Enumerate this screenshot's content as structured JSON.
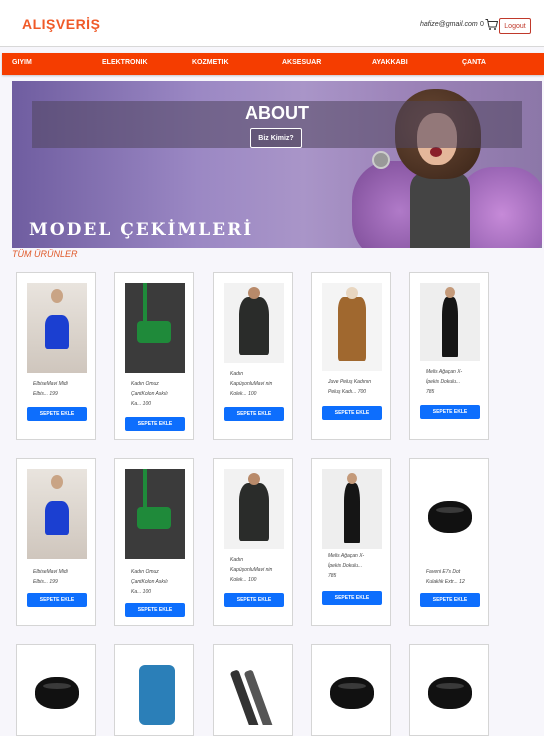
{
  "header": {
    "brand": "ALIŞVERİŞ",
    "email": "hafize@gmail.com",
    "cart_count": "0",
    "logout_label": "Logout"
  },
  "nav": {
    "items": [
      "GIYIM",
      "ELEKTRONIK",
      "KOZMETIK",
      "AKSESUAR",
      "AYAKKABI",
      "ÇANTA"
    ]
  },
  "hero": {
    "title": "ABOUT",
    "button_label": "Biz Kimiz?",
    "caption": "MODEL ÇEKİMLERİ"
  },
  "section_title": "TÜM ÜRÜNLER",
  "add_to_cart_label": "SEPETE EKLE",
  "products": [
    {
      "l1": "ElbiseMavi Midi",
      "l2": "Elbis... 199",
      "l3": ""
    },
    {
      "l1": "Kadın Omuz",
      "l2": "ÇantKolon Askılı",
      "l3": "Ka... 100"
    },
    {
      "l1": "Kadın",
      "l2": "KapüşonluMavi nin",
      "l3": "Kolek... 100"
    },
    {
      "l1": "Juve Peluş Kadının",
      "l2": "Peluş Kadı... 700",
      "l3": ""
    },
    {
      "l1": "Melis Ağaçan X-",
      "l2": "İpekis Dokulu...",
      "l3": "785"
    },
    {
      "l1": "ElbiseMavi Midi",
      "l2": "Elbis... 199",
      "l3": ""
    },
    {
      "l1": "Kadın Omuz",
      "l2": "ÇantKolon Askılı",
      "l3": "Ka... 100"
    },
    {
      "l1": "Kadın",
      "l2": "KapüşonluMavi nin",
      "l3": "Kolek... 100"
    },
    {
      "l1": "Melis Ağaçan X-",
      "l2": "İpekis Dokulu...",
      "l3": "785"
    },
    {
      "l1": "Faveni E7s Dot",
      "l2": "Kulaklık Extr... 12",
      "l3": ""
    },
    {
      "l1": "",
      "l2": "",
      "l3": ""
    },
    {
      "l1": "",
      "l2": "",
      "l3": ""
    },
    {
      "l1": "",
      "l2": "",
      "l3": ""
    },
    {
      "l1": "",
      "l2": "",
      "l3": ""
    },
    {
      "l1": "",
      "l2": "",
      "l3": ""
    }
  ]
}
